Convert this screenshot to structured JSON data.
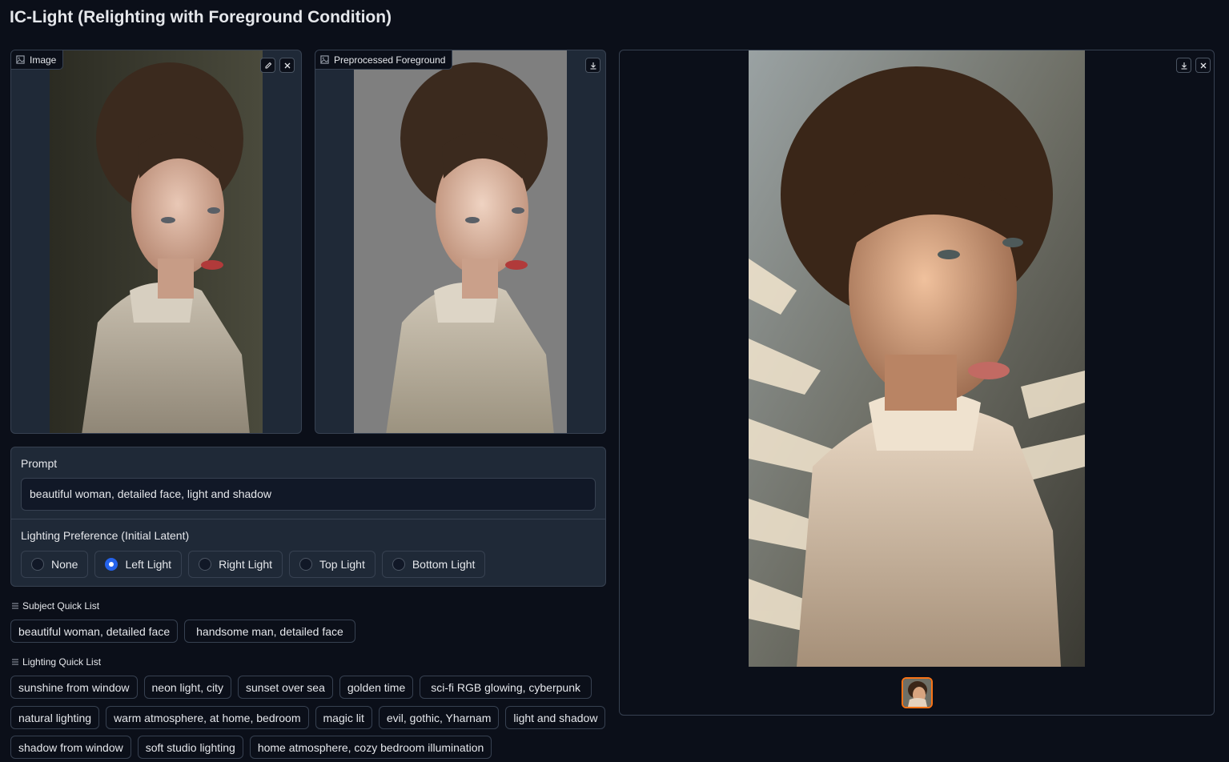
{
  "app": {
    "title": "IC-Light (Relighting with Foreground Condition)"
  },
  "image_input": {
    "label": "Image"
  },
  "preprocessed": {
    "label": "Preprocessed Foreground"
  },
  "prompt": {
    "label": "Prompt",
    "value": "beautiful woman, detailed face, light and shadow"
  },
  "lighting_preference": {
    "label": "Lighting Preference (Initial Latent)",
    "options": [
      "None",
      "Left Light",
      "Right Light",
      "Top Light",
      "Bottom Light"
    ],
    "selected": "Left Light"
  },
  "subject_quick_list": {
    "label": "Subject Quick List",
    "items": [
      "beautiful woman, detailed face",
      "handsome man, detailed face"
    ]
  },
  "lighting_quick_list": {
    "label": "Lighting Quick List",
    "rows": [
      [
        "sunshine from window",
        "neon light, city",
        "sunset over sea",
        "golden time",
        "sci-fi RGB glowing, cyberpunk"
      ],
      [
        "natural lighting",
        "warm atmosphere, at home, bedroom",
        "magic lit",
        "evil, gothic, Yharnam",
        "light and shadow"
      ],
      [
        "shadow from window",
        "soft studio lighting",
        "home atmosphere, cozy bedroom illumination"
      ]
    ]
  },
  "colors": {
    "background": "#0b0f19",
    "panel": "#1f2937",
    "border": "#374151",
    "radio_selected": "#2563eb",
    "thumb_selected": "#f97316"
  },
  "icons": [
    "image-icon",
    "edit-icon",
    "close-icon",
    "download-icon",
    "list-icon"
  ]
}
